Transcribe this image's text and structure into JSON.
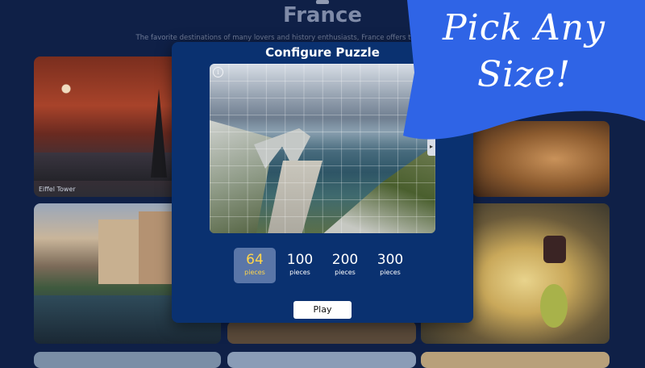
{
  "page": {
    "title": "France",
    "description": "The favorite destinations of many lovers and history enthusiasts, France offers the perfect ingredients for pu"
  },
  "tiles": [
    {
      "caption": "Eiffel Tower"
    }
  ],
  "dialog": {
    "title": "Configure Puzzle",
    "info_icon": "i",
    "piece_options": [
      {
        "count": "64",
        "label": "pieces",
        "selected": true
      },
      {
        "count": "100",
        "label": "pieces",
        "selected": false
      },
      {
        "count": "200",
        "label": "pieces",
        "selected": false
      },
      {
        "count": "300",
        "label": "pieces",
        "selected": false
      }
    ],
    "play_label": "Play"
  },
  "promo": {
    "line1": "Pick Any",
    "line2": "Size!"
  },
  "colors": {
    "background": "#0f2047",
    "dialog": "#0a3170",
    "selected_option": "#5a76a8",
    "selected_text": "#ffd54a",
    "promo_banner": "#2f64e6"
  },
  "icons": {
    "info": "info-icon",
    "side_handle": "chevron-right-icon"
  }
}
